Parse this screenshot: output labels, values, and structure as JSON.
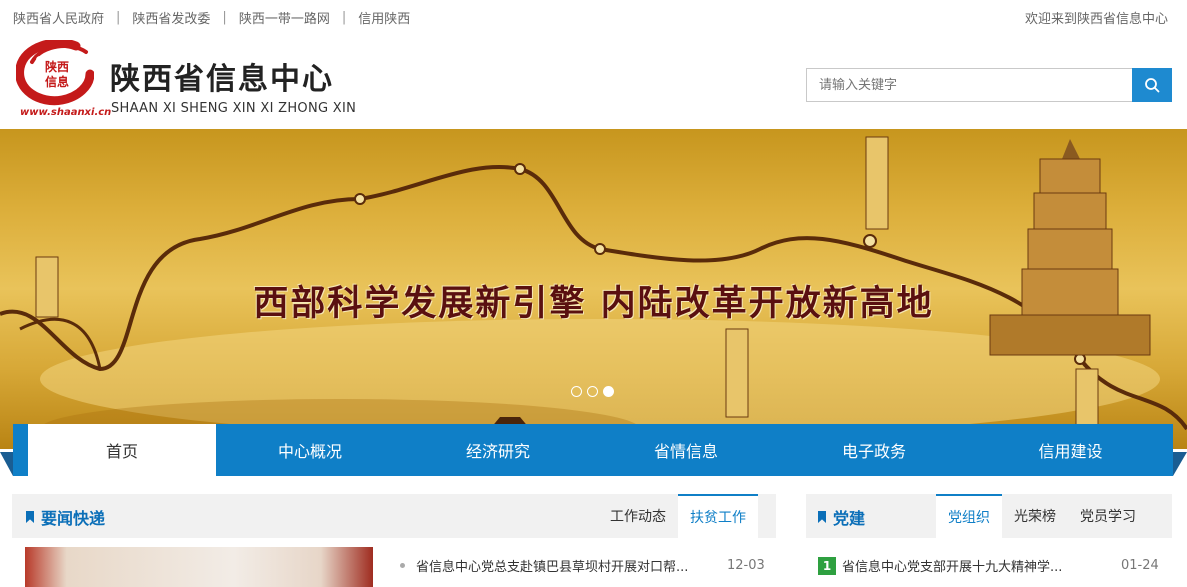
{
  "topbar": {
    "links": [
      "陕西省人民政府",
      "陕西省发改委",
      "陕西一带一路网",
      "信用陕西"
    ],
    "separator": "|",
    "welcome": "欢迎来到陕西省信息中心"
  },
  "header": {
    "logo_chars": "陕西信息",
    "logo_url": "www.shaanxi.cn",
    "title": "陕西省信息中心",
    "subtitle": "SHAAN XI SHENG XIN XI ZHONG XIN"
  },
  "search": {
    "placeholder": "请输入关键字",
    "icon": "search-icon"
  },
  "banner": {
    "slogan": "西部科学发展新引擎  内陆改革开放新高地",
    "slide_count": 3,
    "active_slide": 3
  },
  "nav": {
    "items": [
      "首页",
      "中心概况",
      "经济研究",
      "省情信息",
      "电子政务",
      "信用建设"
    ],
    "active_index": 0
  },
  "news_panel": {
    "title": "要闻快递",
    "tabs": [
      "工作动态",
      "扶贫工作"
    ],
    "active_tab": 1,
    "items": [
      {
        "text": "省信息中心党总支赴镇巴县草坝村开展对口帮...",
        "date": "12-03"
      }
    ]
  },
  "party_panel": {
    "title": "党建",
    "tabs": [
      "党组织",
      "光荣榜",
      "党员学习"
    ],
    "active_tab": 0,
    "items": [
      {
        "rank": "1",
        "text": "省信息中心党支部开展十九大精神学...",
        "date": "01-24"
      }
    ]
  },
  "colors": {
    "primary_blue": "#0f7fc7",
    "logo_red": "#c41a1a",
    "rank_green": "#2ea040"
  }
}
